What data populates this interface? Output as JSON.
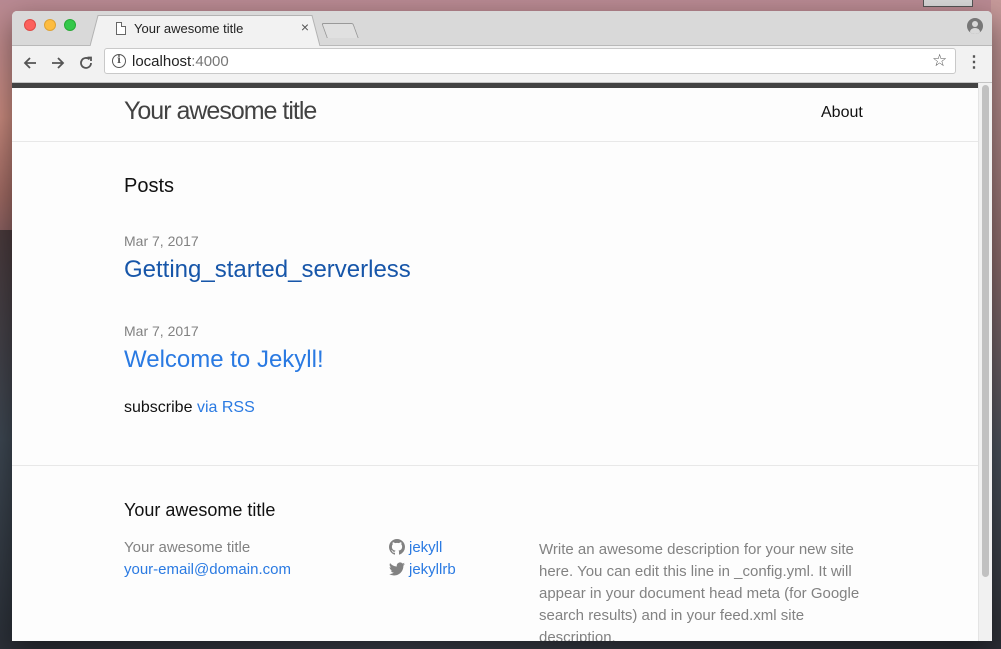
{
  "browser": {
    "tab_title": "Your awesome title",
    "tab_close": "×",
    "url_host": "localhost",
    "url_port": ":4000",
    "info_glyph": "i",
    "icons": [
      "back-arrow-icon",
      "forward-arrow-icon",
      "reload-icon",
      "info-icon",
      "star-icon",
      "menu-icon",
      "profile-icon",
      "page-icon"
    ]
  },
  "site": {
    "title": "Your awesome title",
    "nav": {
      "about": "About"
    },
    "posts_heading": "Posts",
    "posts": [
      {
        "date": "Mar 7, 2017",
        "title": "Getting_started_serverless"
      },
      {
        "date": "Mar 7, 2017",
        "title": "Welcome to Jekyll!"
      }
    ],
    "subscribe_text": "subscribe",
    "subscribe_link": "via RSS",
    "footer": {
      "heading": "Your awesome title",
      "name": "Your awesome title",
      "email": "your-email@domain.com",
      "github": "jekyll",
      "twitter": "jekyllrb",
      "description": "Write an awesome description for your new site here. You can edit this line in _config.yml. It will appear in your document head meta (for Google search results) and in your feed.xml site description."
    }
  },
  "colors": {
    "link": "#2a7ae2",
    "link_visited": "#1756a9",
    "meta_gray": "#828282"
  }
}
